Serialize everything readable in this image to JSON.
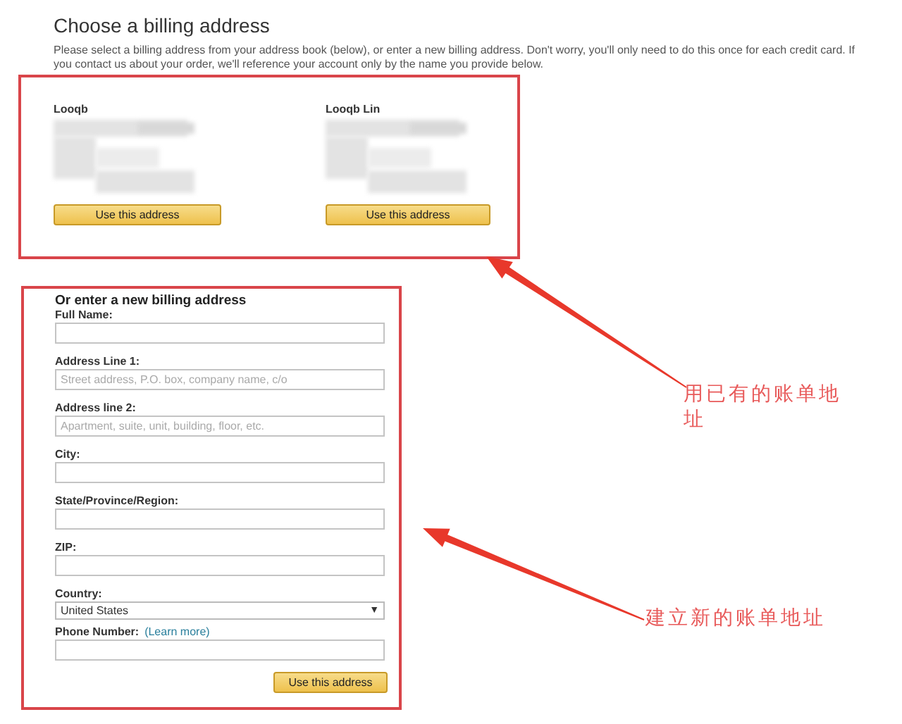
{
  "title": "Choose a billing address",
  "intro": "Please select a billing address from your address book (below), or enter a new billing address.  Don't worry, you'll only need to do this once for each credit card. If you contact us about your order, we'll reference your account only by the name you provide below.",
  "saved_addresses": [
    {
      "name": "Looqb",
      "button": "Use this address"
    },
    {
      "name": "Looqb Lin",
      "button": "Use this address"
    }
  ],
  "new_address": {
    "heading": "Or enter a new billing address",
    "fields": [
      {
        "kind": "text",
        "label": "Full Name:"
      },
      {
        "kind": "text",
        "label": "Address Line 1:",
        "placeholder": "Street address, P.O. box, company name, c/o"
      },
      {
        "kind": "text",
        "label": "Address line 2:",
        "placeholder": "Apartment, suite, unit, building, floor, etc."
      },
      {
        "kind": "text",
        "label": "City:"
      },
      {
        "kind": "text",
        "label": "State/Province/Region:"
      },
      {
        "kind": "text",
        "label": "ZIP:"
      },
      {
        "kind": "select",
        "label": "Country:",
        "value": "United States",
        "caret": "▼"
      },
      {
        "kind": "text",
        "label": "Phone Number:",
        "link": "(Learn more)"
      }
    ],
    "button": "Use this address"
  },
  "annotations": [
    {
      "text": "用已有的账单地址",
      "kind": "upper"
    },
    {
      "text": "建立新的账单地址",
      "kind": "lower"
    }
  ]
}
